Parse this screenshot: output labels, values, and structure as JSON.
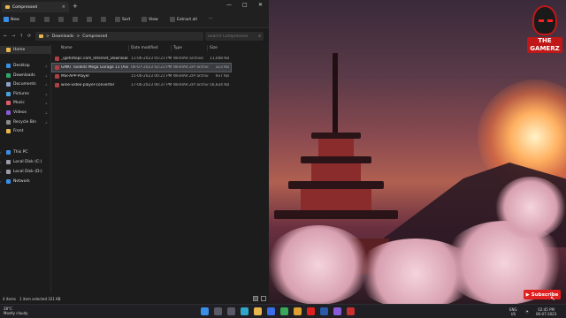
{
  "window": {
    "tab_title": "Compressed",
    "tab_close": "×",
    "tab_add": "+",
    "minimize": "—",
    "maximize": "□",
    "close": "✕"
  },
  "toolbar": {
    "new_label": "New",
    "sort_label": "Sort",
    "view_label": "View",
    "extract_all_label": "Extract all",
    "more_label": "···"
  },
  "address": {
    "segments": [
      "Downloads",
      "Compressed"
    ],
    "separator": ">",
    "search_placeholder": "Search Compressed"
  },
  "nav": {
    "home": "Home",
    "quick_access": [
      {
        "label": "Desktop",
        "color": "#3a8ee6"
      },
      {
        "label": "Downloads",
        "color": "#2fa86a"
      },
      {
        "label": "Documents",
        "color": "#8aa0c8"
      },
      {
        "label": "Pictures",
        "color": "#4aa0d8"
      },
      {
        "label": "Music",
        "color": "#e05a6a"
      },
      {
        "label": "Videos",
        "color": "#8a5ad8"
      },
      {
        "label": "Recycle Bin",
        "color": "#8a8a8a"
      },
      {
        "label": "Front",
        "color": "#e8b64c"
      }
    ],
    "pin": "📌",
    "this_pc": "This PC",
    "drives": [
      "Local Disk (C:)",
      "Local Disk (D:)"
    ],
    "network": "Network"
  },
  "columns": {
    "name": "Name",
    "date": "Date modified",
    "type": "Type",
    "size": "Size"
  },
  "files": [
    {
      "name": "_igetintopc.com_Internet_Download_Ma...",
      "date": "11-06-2023 05:21 PM",
      "type": "WinRAR archive",
      "size": "11,048 KB",
      "icon_color": "#b04040"
    },
    {
      "name": "GMKT Toolkits Mega Garage 11 (Axiom...",
      "date": "06-07-2023 02:23 PM",
      "type": "WinRAR ZIP archive",
      "size": "323 KB",
      "icon_color": "#b04040"
    },
    {
      "name": "MSI-APP-Player",
      "date": "15-06-2023 06:21 PM",
      "type": "WinRAR ZIP archive",
      "size": "937 KB",
      "icon_color": "#b04040"
    },
    {
      "name": "wine-video-player-converter",
      "date": "17-06-2023 06:37 PM",
      "type": "WinRAR ZIP archive",
      "size": "56,834 KB",
      "icon_color": "#b04040"
    }
  ],
  "status": {
    "items": "4 items",
    "selected": "1 item selected  321 KB"
  },
  "logo": {
    "text": "THE GAMERZ"
  },
  "subscribe": {
    "label": "Subscribe",
    "icon": "▶"
  },
  "taskbar": {
    "weather_temp": "28°C",
    "weather_desc": "Mostly cloudy",
    "apps": [
      {
        "name": "start-icon",
        "color": "#3a8ee6"
      },
      {
        "name": "search-icon",
        "color": "#5a5a66"
      },
      {
        "name": "task-view-icon",
        "color": "#5a5a66"
      },
      {
        "name": "edge-icon",
        "color": "#2fa8c8"
      },
      {
        "name": "explorer-icon",
        "color": "#e8b64c"
      },
      {
        "name": "store-icon",
        "color": "#3a6ee6"
      },
      {
        "name": "chrome-icon",
        "color": "#3aa85a"
      },
      {
        "name": "mail-icon",
        "color": "#e0a030"
      },
      {
        "name": "youtube-icon",
        "color": "#e02020"
      },
      {
        "name": "photoshop-icon",
        "color": "#2a5aa8"
      },
      {
        "name": "app-icon",
        "color": "#8a5ad8"
      },
      {
        "name": "browser-icon",
        "color": "#c83030"
      }
    ],
    "lang_1": "ENG",
    "lang_2": "US",
    "time": "02:45 PM",
    "date": "06-07-2023"
  }
}
